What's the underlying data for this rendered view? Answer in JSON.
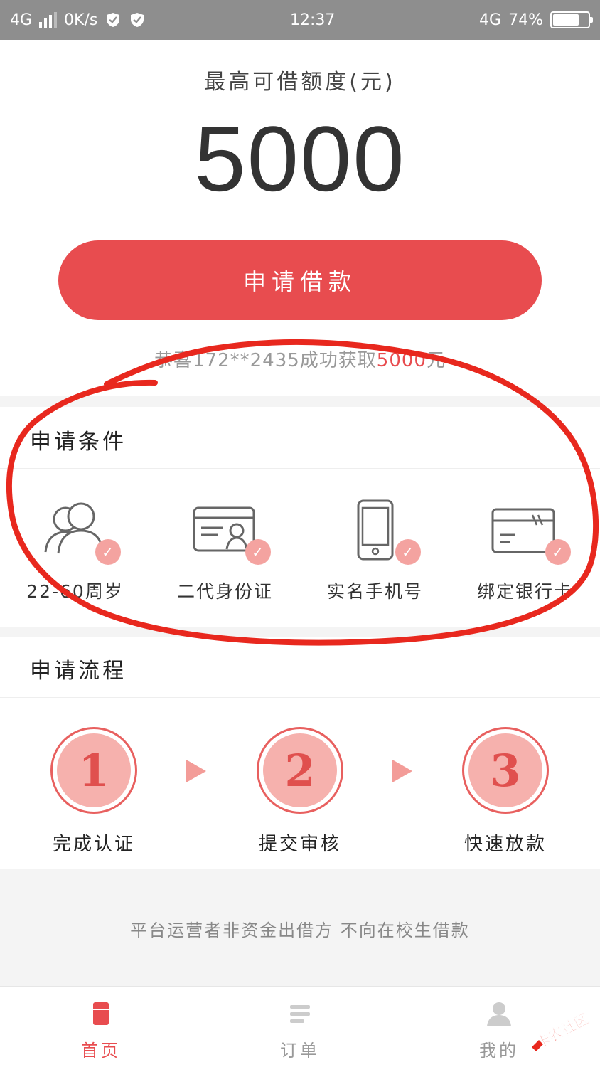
{
  "status_bar": {
    "network_left": "4G",
    "speed": "0K/s",
    "time": "12:37",
    "network_right": "4G",
    "battery": "74%",
    "battery_level": 0.74
  },
  "loan": {
    "limit_label": "最高可借额度(元)",
    "limit_amount": "5000",
    "apply_label": "申请借款",
    "notice_prefix": "恭喜172**2435成功获取",
    "notice_amount": "5000",
    "notice_suffix": "元"
  },
  "conditions": {
    "title": "申请条件",
    "items": [
      {
        "label": "22-60周岁",
        "icon": "users-icon"
      },
      {
        "label": "二代身份证",
        "icon": "id-card-icon"
      },
      {
        "label": "实名手机号",
        "icon": "phone-icon"
      },
      {
        "label": "绑定银行卡",
        "icon": "bank-card-icon"
      }
    ]
  },
  "process": {
    "title": "申请流程",
    "steps": [
      {
        "number": "1",
        "label": "完成认证"
      },
      {
        "number": "2",
        "label": "提交审核"
      },
      {
        "number": "3",
        "label": "快速放款"
      }
    ]
  },
  "disclaimer": "平台运营者非资金出借方 不向在校生借款",
  "nav": {
    "items": [
      {
        "label": "首页",
        "icon": "home-icon",
        "active": true
      },
      {
        "label": "订单",
        "icon": "orders-icon",
        "active": false
      },
      {
        "label": "我的",
        "icon": "profile-icon",
        "active": false
      }
    ]
  },
  "watermark": "卡农社区",
  "colors": {
    "accent": "#e84c4f",
    "badge": "#f4a3a0",
    "step_fill": "#f6b1ad",
    "annotation": "#e8281e"
  }
}
